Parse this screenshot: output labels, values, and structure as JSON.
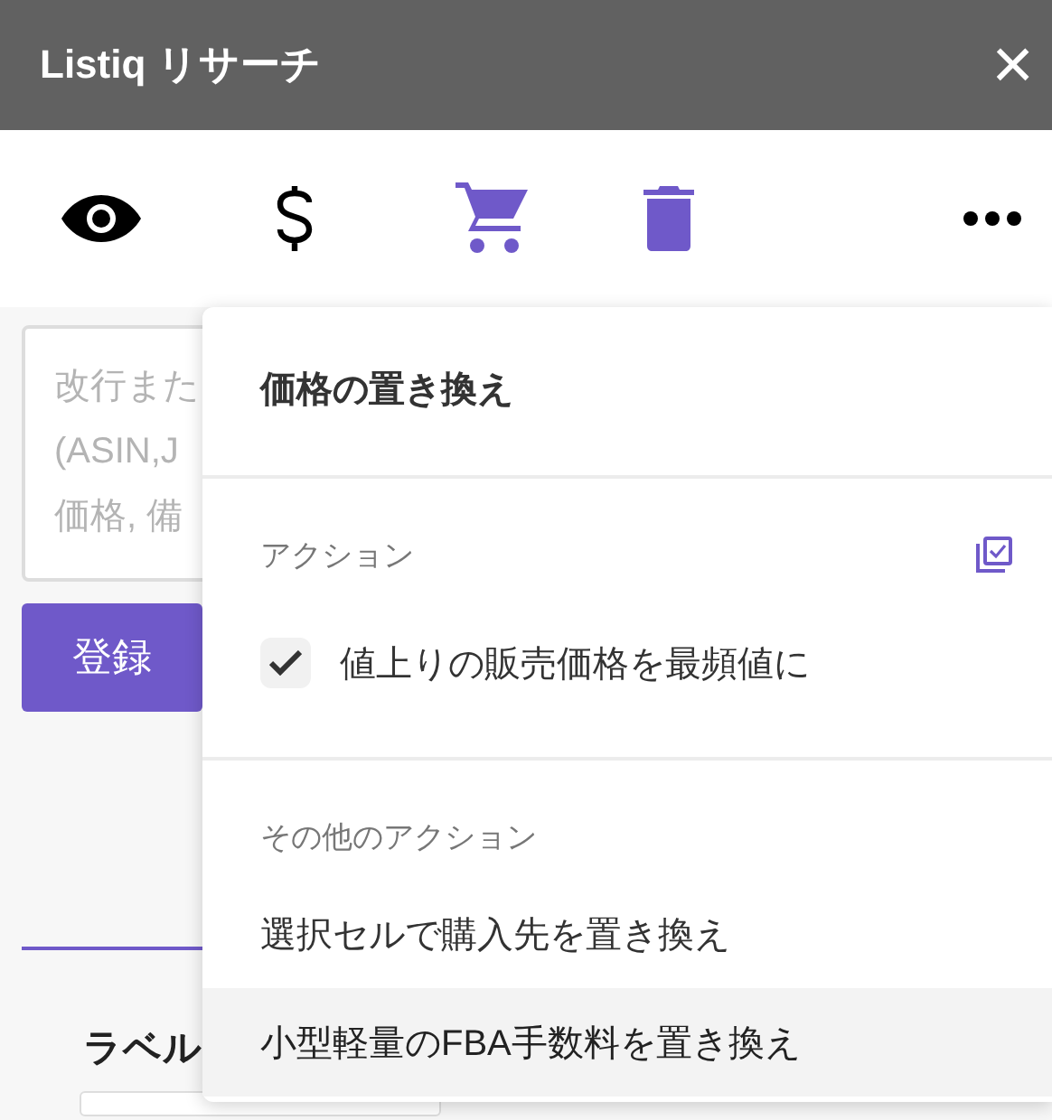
{
  "window": {
    "title": "Listiq リサーチ",
    "close": "×"
  },
  "toolbar": [
    {
      "kind": "eye",
      "highlighted": false
    },
    {
      "kind": "dollar",
      "highlighted": false
    },
    {
      "kind": "cart",
      "highlighted": true
    },
    {
      "kind": "trash",
      "highlighted": true
    },
    {
      "kind": "more",
      "highlighted": false
    }
  ],
  "form": {
    "input": {
      "placeholder": "改行また\n(ASIN,J\n価格, 備"
    },
    "submit": "登録",
    "label": "ラベル"
  },
  "menu": {
    "title": "価格の置き換え",
    "sections": [
      {
        "title": "アクション",
        "has_select_all": true,
        "items": [
          {
            "kind": "checkbox",
            "label": "値上りの販売価格を最頻値に",
            "checked": true,
            "highlighted": false
          }
        ]
      },
      {
        "title": "その他のアクション",
        "has_select_all": false,
        "items": [
          {
            "kind": "action",
            "label": "選択セルで購入先を置き換え",
            "highlighted": false
          },
          {
            "kind": "action",
            "label": "小型軽量のFBA手数料を置き換え",
            "highlighted": true
          }
        ]
      }
    ]
  }
}
